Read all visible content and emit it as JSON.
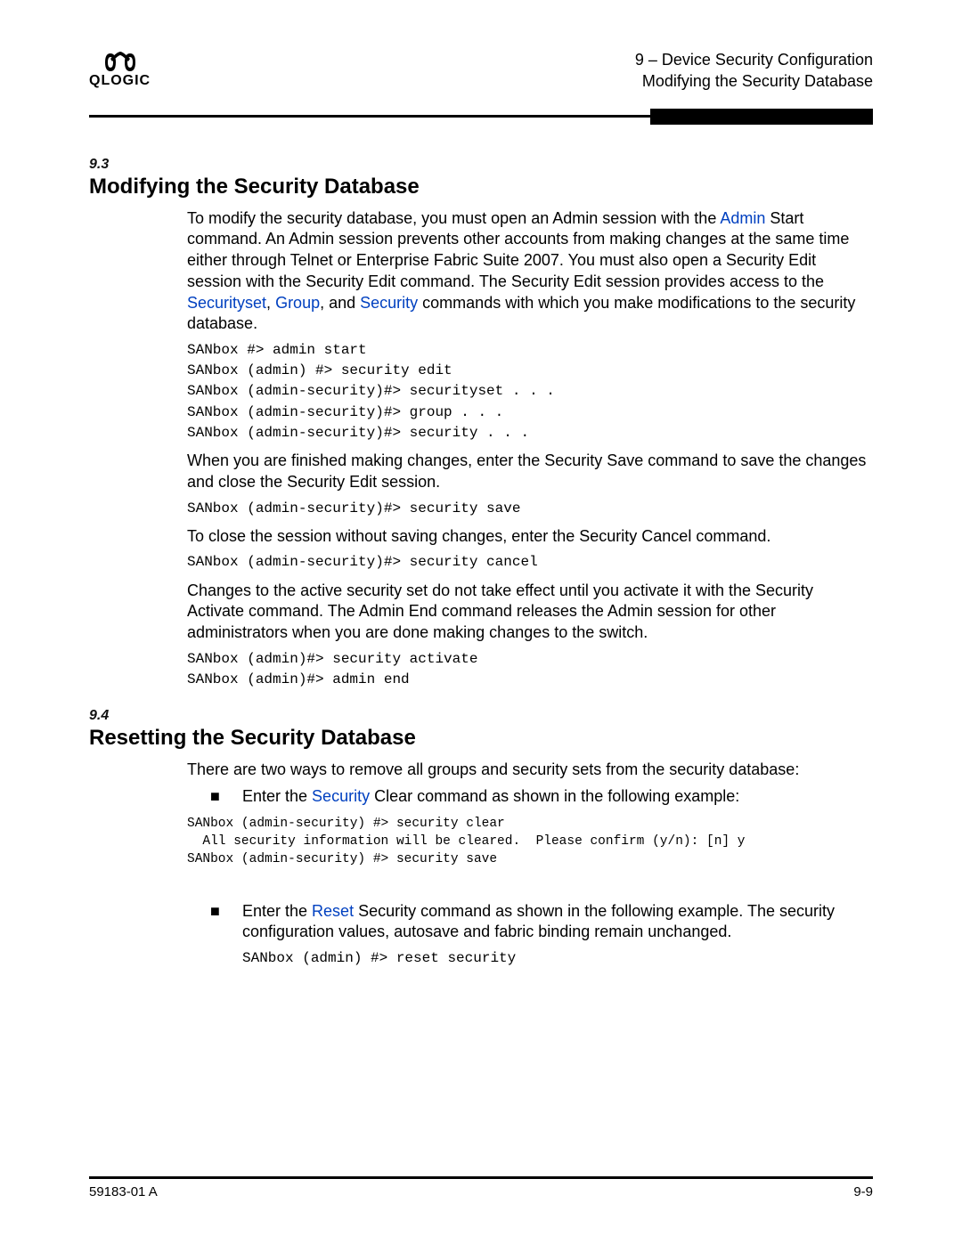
{
  "header": {
    "logo_text": "QLOGIC",
    "chapter_ref": "9 – Device Security Configuration",
    "section_ref": "Modifying the Security Database"
  },
  "section1": {
    "num": "9.3",
    "title": "Modifying the Security Database",
    "p1_a": "To modify the security database, you must open an Admin session with the ",
    "link_admin": "Admin",
    "p1_b": " Start command. An Admin session prevents other accounts from making changes at the same time either through Telnet or Enterprise Fabric Suite 2007. You must also open a Security Edit session with the Security Edit command. The Security Edit session provides access to the ",
    "link_securityset": "Securityset",
    "p1_c": ", ",
    "link_group": "Group",
    "p1_d": ", and ",
    "link_security": "Security",
    "p1_e": " commands with which you make modifications to the security database.",
    "code1": "SANbox #> admin start\nSANbox (admin) #> security edit\nSANbox (admin-security)#> securityset . . .\nSANbox (admin-security)#> group . . .\nSANbox (admin-security)#> security . . .",
    "p2": "When you are finished making changes, enter the Security Save command to save the changes and close the Security Edit session.",
    "code2": "SANbox (admin-security)#> security save",
    "p3": "To close the session without saving changes, enter the Security Cancel command.",
    "code3": "SANbox (admin-security)#> security cancel",
    "p4": "Changes to the active security set do not take effect until you activate it with the Security Activate command. The Admin End command releases the Admin session for other administrators when you are done making changes to the switch.",
    "code4": "SANbox (admin)#> security activate\nSANbox (admin)#> admin end"
  },
  "section2": {
    "num": "9.4",
    "title": "Resetting the Security Database",
    "p1": "There are two ways to remove all groups and security sets from the security database:",
    "b1_a": "Enter the ",
    "b1_link": "Security",
    "b1_b": " Clear command as shown in the following example:",
    "code1": "SANbox (admin-security) #> security clear\n  All security information will be cleared.  Please confirm (y/n): [n] y\nSANbox (admin-security) #> security save",
    "b2_a": "Enter the ",
    "b2_link": "Reset",
    "b2_b": " Security command as shown in the following example. The security configuration values, autosave and fabric binding remain unchanged.",
    "code2": "SANbox (admin) #> reset security"
  },
  "footer": {
    "left": "59183-01 A",
    "right": "9-9"
  }
}
